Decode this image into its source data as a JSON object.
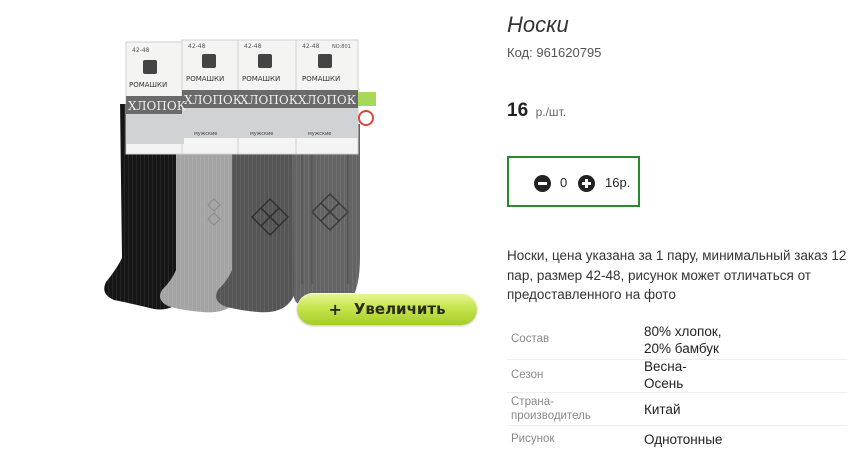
{
  "product": {
    "title": "Носки",
    "code_label": "Код:",
    "code_value": "961620795",
    "price_value": "16",
    "price_unit": "р./шт.",
    "description": "Носки, цена указана за 1 пару, минимальный заказ 12 пар, размер 42-48, рисунок может отличаться от предоставленного на фото"
  },
  "photo": {
    "brand": "РОМАШКИ",
    "material": "ХЛОПОК",
    "size": "42-48",
    "article": "NO:801",
    "line": "мужские",
    "zoom_label": "Увеличить",
    "zoom_icon": "+"
  },
  "quantity": {
    "value": "0",
    "total": "16р.",
    "minus_icon": "minus-circle-icon",
    "plus_icon": "plus-circle-icon",
    "border_color": "#2a8a2a"
  },
  "attributes": [
    {
      "label": "Состав",
      "value_lines": [
        "80% хлопок,",
        "20% бамбук"
      ]
    },
    {
      "label": "Сезон",
      "value_lines": [
        "Весна-",
        "Осень"
      ]
    },
    {
      "label": "Страна-производитель",
      "label_lines": [
        "Страна-",
        "производитель"
      ],
      "value_lines": [
        "Китай"
      ]
    },
    {
      "label": "Рисунок",
      "value_lines": [
        "Однотонные"
      ]
    }
  ],
  "colors": {
    "accent_green": "#2a8a2a",
    "zoom_button": "#b6d93a"
  }
}
